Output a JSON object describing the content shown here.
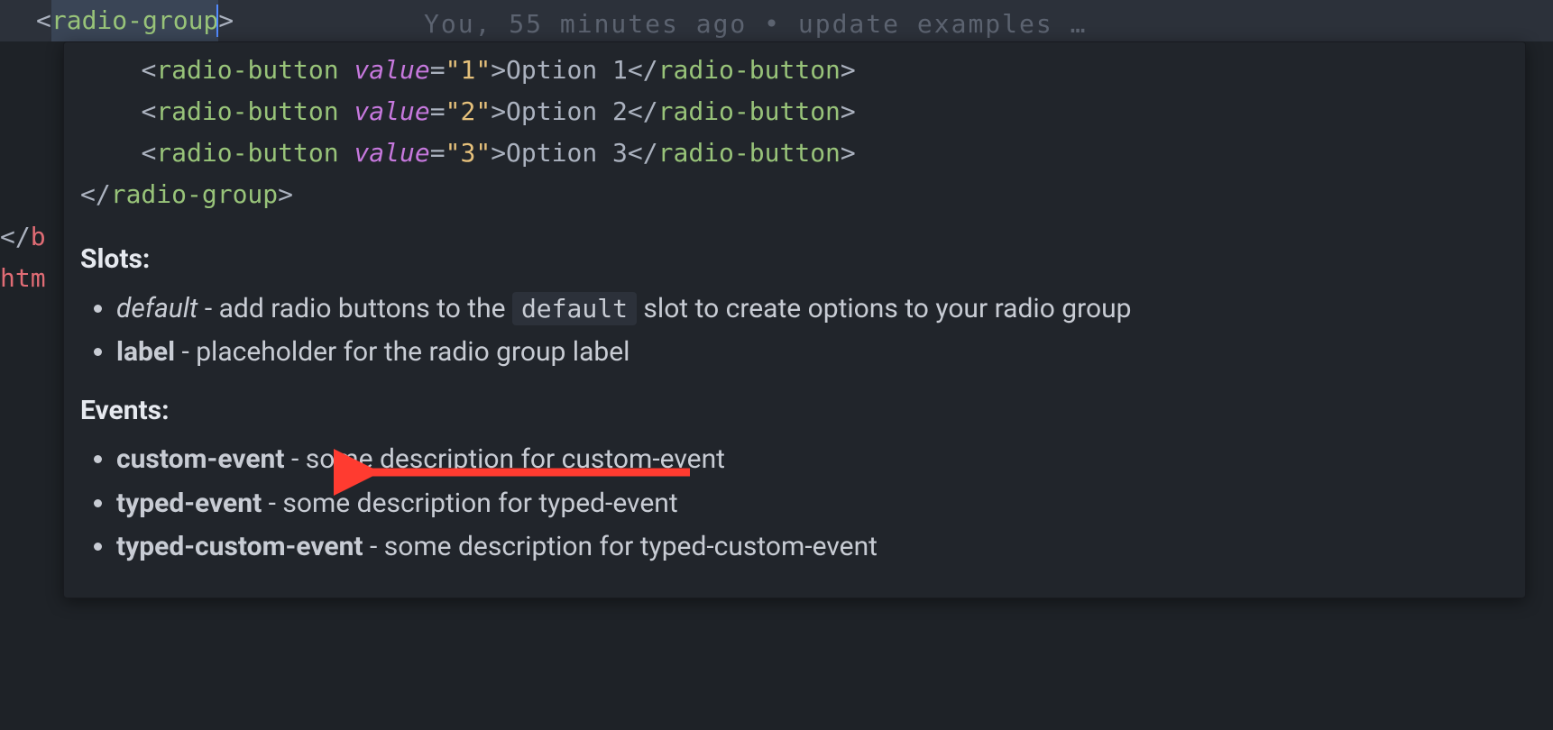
{
  "topLine": {
    "tagName": "radio-group"
  },
  "codelens": "You, 55 minutes ago • update examples …",
  "leftFragments": {
    "line1_prefix": "</",
    "line1_tag": "b",
    "line2_tag": "htm"
  },
  "snippet": {
    "indent": "    ",
    "lines": [
      {
        "tag": "radio-button",
        "attr": "value",
        "val": "\"1\"",
        "text": "Option 1"
      },
      {
        "tag": "radio-button",
        "attr": "value",
        "val": "\"2\"",
        "text": "Option 2"
      },
      {
        "tag": "radio-button",
        "attr": "value",
        "val": "\"3\"",
        "text": "Option 3"
      }
    ],
    "closeTag": "radio-group"
  },
  "slotsHeading": "Slots:",
  "slots": [
    {
      "name": "default",
      "italic": true,
      "desc_before": " - add radio buttons to the ",
      "code": "default",
      "desc_after": " slot to create options to your radio group"
    },
    {
      "name": "label",
      "italic": false,
      "desc_before": " - placeholder for the radio group label",
      "code": null,
      "desc_after": ""
    }
  ],
  "eventsHeading": "Events:",
  "events": [
    {
      "name": "custom-event",
      "desc": " - some description for custom-event"
    },
    {
      "name": "typed-event",
      "desc": " - some description for typed-event"
    },
    {
      "name": "typed-custom-event",
      "desc": " - some description for typed-custom-event"
    }
  ],
  "arrowColor": "#ff3b30"
}
